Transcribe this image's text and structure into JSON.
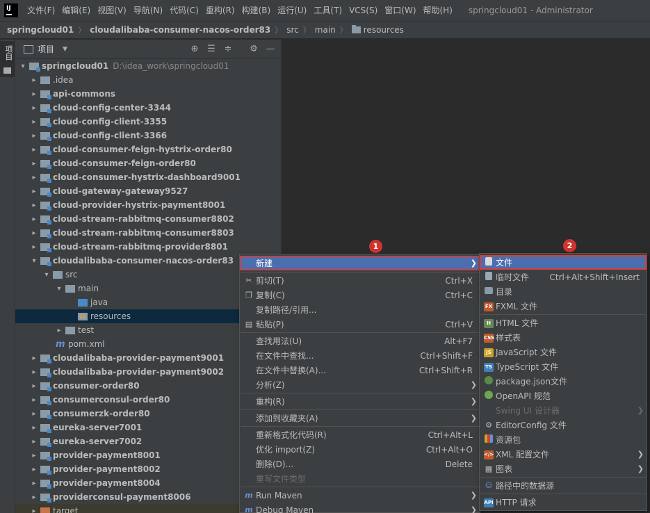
{
  "app": {
    "logo": "IJ",
    "window_title": "springcloud01 - Administrator",
    "menu": [
      "文件(F)",
      "编辑(E)",
      "视图(V)",
      "导航(N)",
      "代码(C)",
      "重构(R)",
      "构建(B)",
      "运行(U)",
      "工具(T)",
      "VCS(S)",
      "窗口(W)",
      "帮助(H)"
    ]
  },
  "breadcrumb": [
    "springcloud01",
    "cloudalibaba-consumer-nacos-order83",
    "src",
    "main",
    "resources"
  ],
  "tool_strip": {
    "label": "项目"
  },
  "project_panel": {
    "title": "项目",
    "root_label": "springcloud01",
    "root_path": "D:\\idea_work\\springcloud01",
    "modules_before": [
      ".idea",
      "api-commons",
      "cloud-config-center-3344",
      "cloud-config-client-3355",
      "cloud-config-client-3366",
      "cloud-consumer-feign-hystrix-order80",
      "cloud-consumer-feign-order80",
      "cloud-consumer-hystrix-dashboard9001",
      "cloud-gateway-gateway9527",
      "cloud-provider-hystrix-payment8001",
      "cloud-stream-rabbitmq-consumer8802",
      "cloud-stream-rabbitmq-consumer8803",
      "cloud-stream-rabbitmq-provider8801"
    ],
    "open_module": "cloudalibaba-consumer-nacos-order83",
    "src": "src",
    "main": "main",
    "java": "java",
    "resources": "resources",
    "test": "test",
    "pom": "pom.xml",
    "modules_after": [
      "cloudalibaba-provider-payment9001",
      "cloudalibaba-provider-payment9002",
      "consumer-order80",
      "consumerconsul-order80",
      "consumerzk-order80",
      "eureka-server7001",
      "eureka-server7002",
      "provider-payment8001",
      "provider-payment8002",
      "provider-payment8004",
      "providerconsul-payment8006"
    ],
    "target": "target"
  },
  "context_menu": {
    "badge": "1",
    "new": "新建",
    "cut": "剪切(T)",
    "cut_sc": "Ctrl+X",
    "copy": "复制(C)",
    "copy_sc": "Ctrl+C",
    "copy_path": "复制路径/引用...",
    "paste": "粘贴(P)",
    "paste_sc": "Ctrl+V",
    "find_usages": "查找用法(U)",
    "find_usages_sc": "Alt+F7",
    "find_in_files": "在文件中查找...",
    "find_in_files_sc": "Ctrl+Shift+F",
    "replace_in_files": "在文件中替换(A)...",
    "replace_in_files_sc": "Ctrl+Shift+R",
    "analyze": "分析(Z)",
    "refactor": "重构(R)",
    "add_favorites": "添加到收藏夹(A)",
    "reformat": "重新格式化代码(R)",
    "reformat_sc": "Ctrl+Alt+L",
    "optimize_imports": "优化 import(Z)",
    "optimize_imports_sc": "Ctrl+Alt+O",
    "delete": "删除(D)...",
    "delete_sc": "Delete",
    "override_file_type": "重写文件类型",
    "run_maven": "Run Maven",
    "debug_maven": "Debug Maven"
  },
  "submenu": {
    "badge": "2",
    "file": "文件",
    "scratch": "临时文件",
    "scratch_sc": "Ctrl+Alt+Shift+Insert",
    "directory": "目录",
    "fxml": "FXML 文件",
    "html": "HTML 文件",
    "stylesheet": "样式表",
    "javascript": "JavaScript 文件",
    "typescript": "TypeScript 文件",
    "package_json": "package.json文件",
    "openapi": "OpenAPI 规范",
    "swing": "Swing UI 设计器",
    "editorconfig": "EditorConfig 文件",
    "resource_bundle": "资源包",
    "xml_config": "XML 配置文件",
    "diagram": "图表",
    "datasource": "路径中的数据源",
    "http_request": "HTTP 请求"
  },
  "colors": {
    "highlight": "#4b6eaf",
    "annotation": "#d0342c",
    "selection": "#0d293e"
  }
}
